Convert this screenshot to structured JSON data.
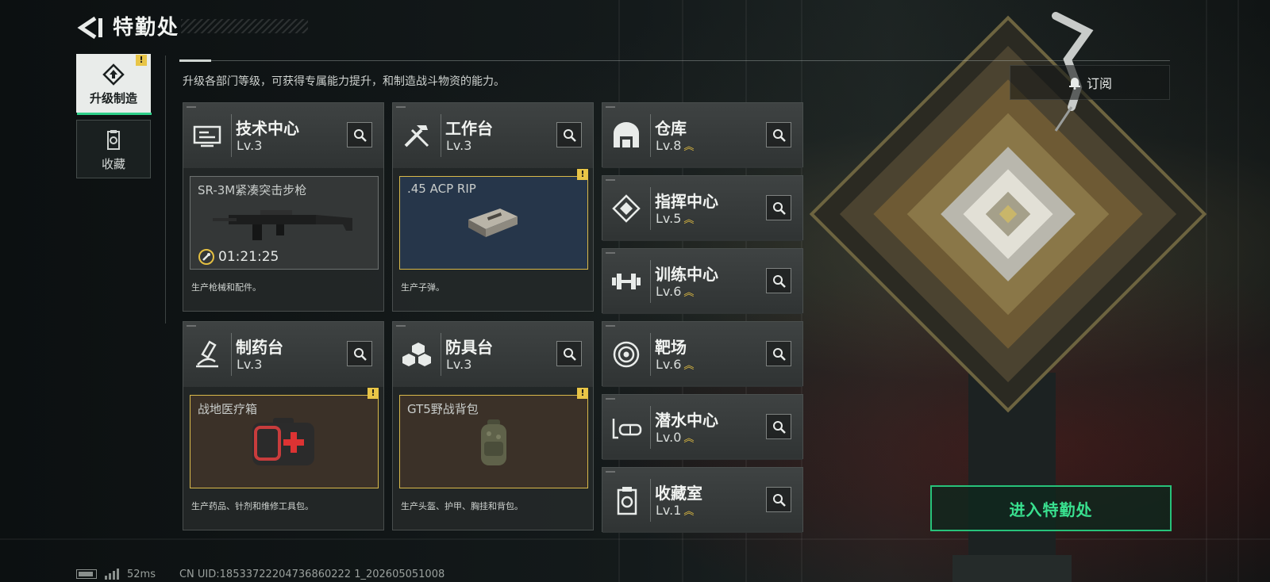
{
  "header": {
    "title": "特勤处",
    "subtitle": "升级各部门等级，可获得专属能力提升，和制造战斗物资的能力。",
    "subscribe_label": "订阅"
  },
  "sidebar": {
    "items": [
      {
        "label": "升级制造",
        "active": true,
        "alert": "!"
      },
      {
        "label": "收藏",
        "active": false
      }
    ]
  },
  "workshops": [
    {
      "name": "技术中心",
      "level": "Lv.3",
      "icon": "tech-center-icon",
      "item": {
        "name": "SR-3M紧凑突击步枪",
        "timer": "01:21:25",
        "style": "gray"
      },
      "description": "生产枪械和配件。"
    },
    {
      "name": "工作台",
      "level": "Lv.3",
      "icon": "workbench-icon",
      "item": {
        "name": ".45 ACP RIP",
        "style": "blue",
        "alert": "!"
      },
      "description": "生产子弹。"
    },
    {
      "name": "制药台",
      "level": "Lv.3",
      "icon": "pharmacy-icon",
      "item": {
        "name": "战地医疗箱",
        "style": "brown",
        "alert": "!"
      },
      "description": "生产药品、针剂和维修工具包。"
    },
    {
      "name": "防具台",
      "level": "Lv.3",
      "icon": "armor-bench-icon",
      "item": {
        "name": "GT5野战背包",
        "style": "brown",
        "alert": "!"
      },
      "description": "生产头盔、护甲、胸挂和背包。"
    }
  ],
  "departments": [
    {
      "name": "仓库",
      "level": "Lv.8",
      "icon": "warehouse-icon",
      "upgrade_available": true
    },
    {
      "name": "指挥中心",
      "level": "Lv.5",
      "icon": "command-center-icon",
      "upgrade_available": true
    },
    {
      "name": "训练中心",
      "level": "Lv.6",
      "icon": "training-center-icon",
      "upgrade_available": true
    },
    {
      "name": "靶场",
      "level": "Lv.6",
      "icon": "shooting-range-icon",
      "upgrade_available": true
    },
    {
      "name": "潜水中心",
      "level": "Lv.0",
      "icon": "diving-center-icon",
      "upgrade_available": true
    },
    {
      "name": "收藏室",
      "level": "Lv.1",
      "icon": "collection-room-icon",
      "upgrade_available": true
    }
  ],
  "enter_button_label": "进入特勤处",
  "footer": {
    "ping": "52ms",
    "uid": "CN UID:18533722204736860222 1_202605051008"
  },
  "colors": {
    "accent_green": "#27c27a",
    "alert_yellow": "#e8c547",
    "upgrade_chevron": "#e5c042"
  }
}
